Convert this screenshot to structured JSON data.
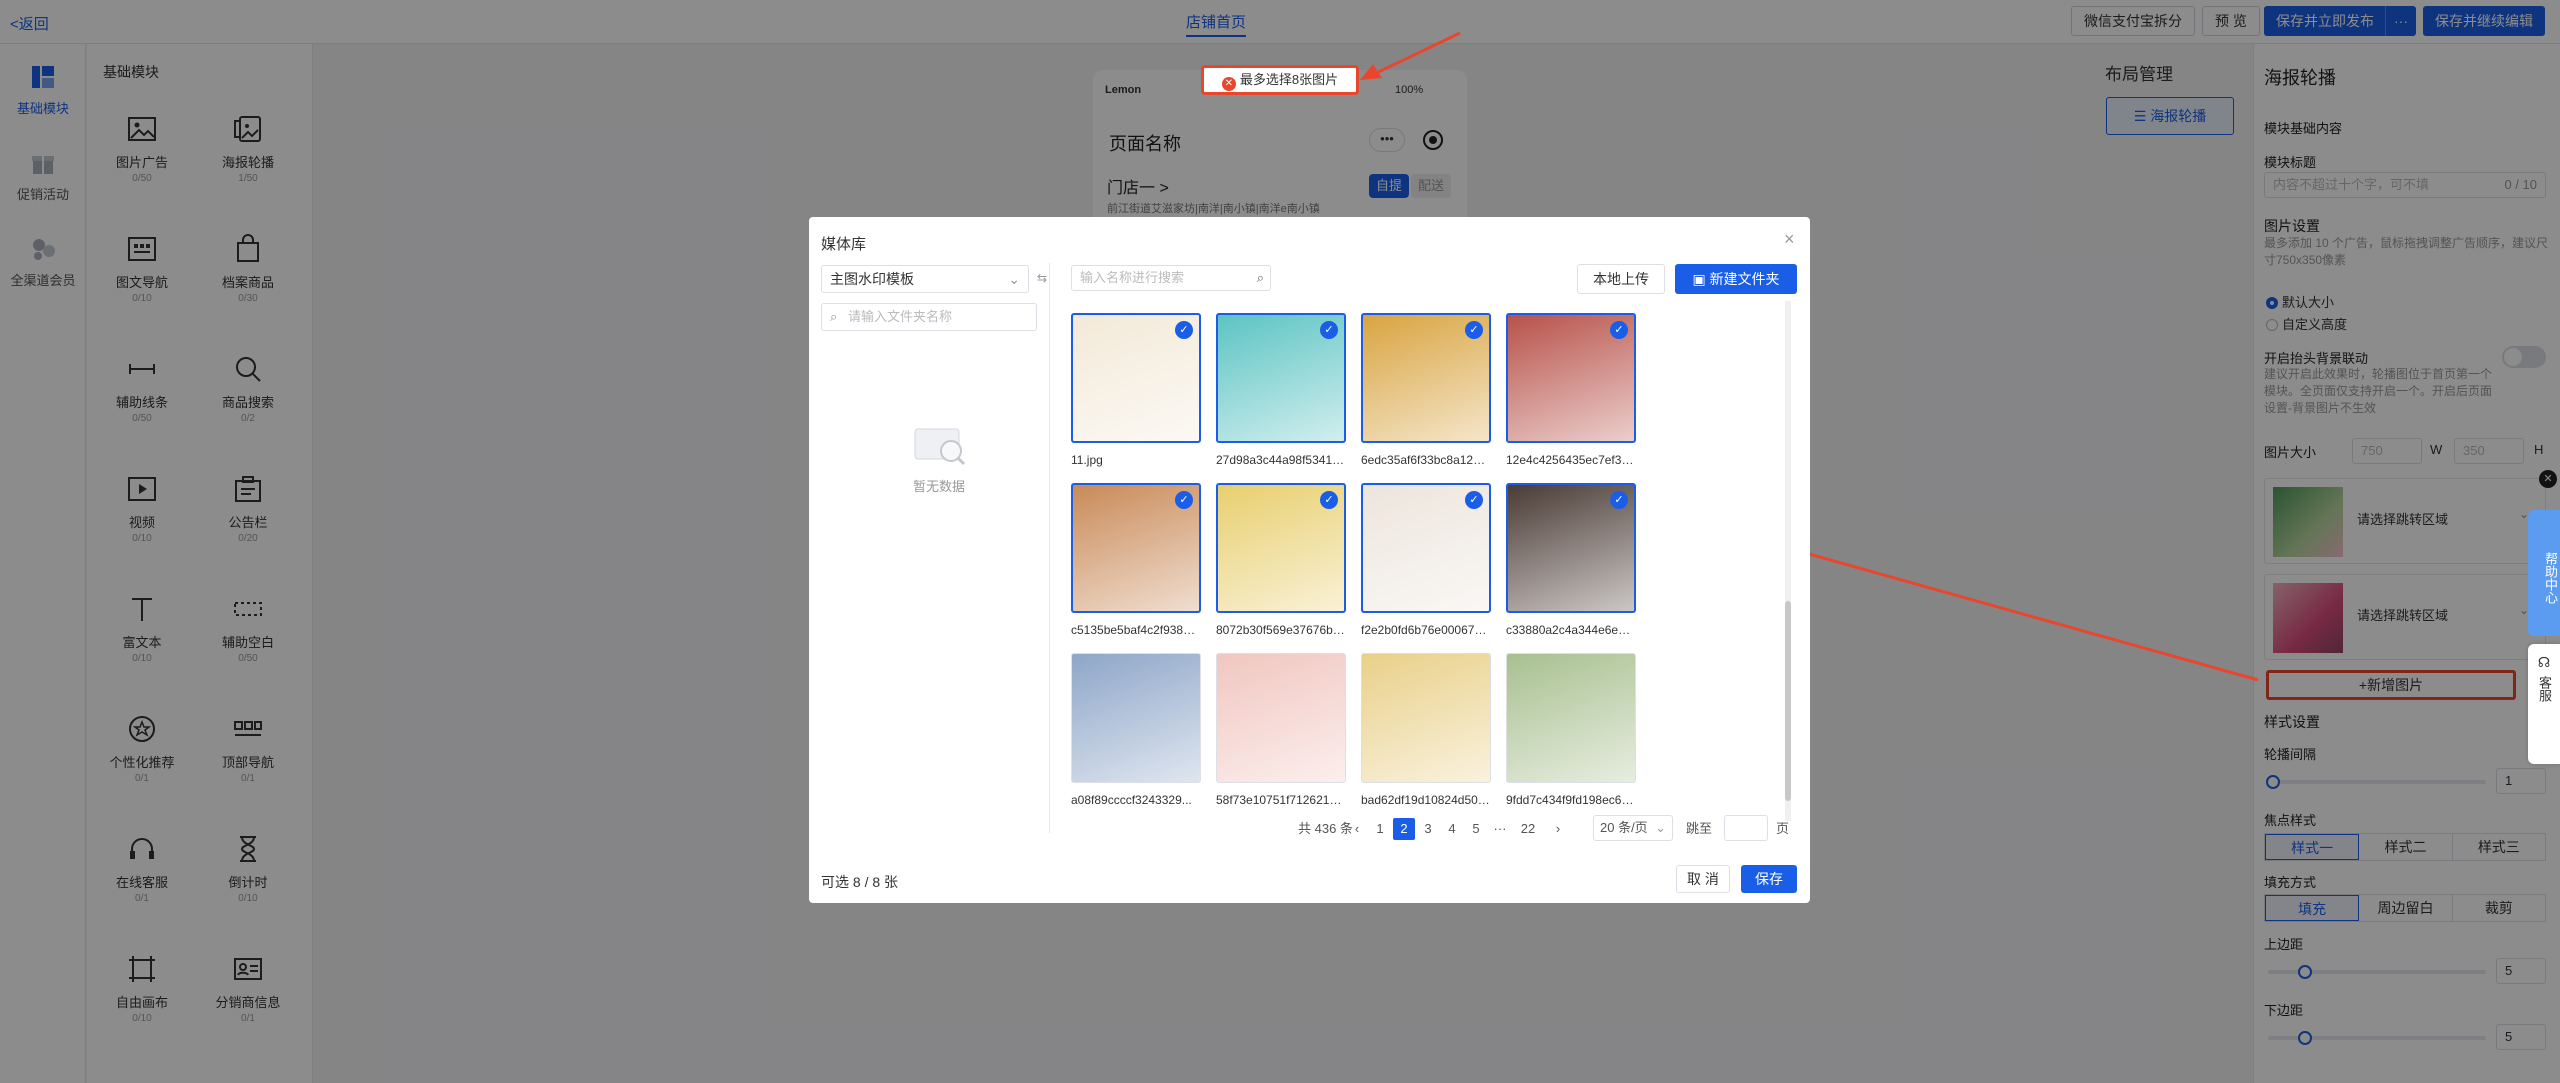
{
  "topbar": {
    "back": "<返回",
    "page_tab": "店铺首页",
    "btn_wechat_split": "微信支付宝拆分",
    "btn_preview": "预 览",
    "btn_save_publish": "保存并立即发布",
    "btn_more": "···",
    "btn_save_continue": "保存并继续编辑"
  },
  "rail": {
    "items": [
      {
        "label": "基础模块"
      },
      {
        "label": "促销活动"
      },
      {
        "label": "全渠道会员"
      }
    ]
  },
  "modules": {
    "header": "基础模块",
    "items": [
      {
        "name": "图片广告",
        "count": "0/50"
      },
      {
        "name": "海报轮播",
        "count": "1/50"
      },
      {
        "name": "图文导航",
        "count": "0/10"
      },
      {
        "name": "档案商品",
        "count": "0/30"
      },
      {
        "name": "辅助线条",
        "count": "0/50"
      },
      {
        "name": "商品搜索",
        "count": "0/2"
      },
      {
        "name": "视频",
        "count": "0/10"
      },
      {
        "name": "公告栏",
        "count": "0/20"
      },
      {
        "name": "富文本",
        "count": "0/10"
      },
      {
        "name": "辅助空白",
        "count": "0/50"
      },
      {
        "name": "个性化推荐",
        "count": "0/1"
      },
      {
        "name": "顶部导航",
        "count": "0/1"
      },
      {
        "name": "在线客服",
        "count": "0/1"
      },
      {
        "name": "倒计时",
        "count": "0/10"
      },
      {
        "name": "自由画布",
        "count": "0/10"
      },
      {
        "name": "分销商信息",
        "count": "0/1"
      }
    ]
  },
  "phone": {
    "carrier": "Lemon",
    "battery": "100%",
    "page_name": "页面名称",
    "store": "门店一 >",
    "address": "前江街道艾滋家坊|南洋|南小镇|南洋e南小镇",
    "tab_pickup": "自提",
    "tab_delivery": "配送"
  },
  "toast": {
    "text": "最多选择8张图片"
  },
  "layout": {
    "title": "布局管理",
    "button": "海报轮播"
  },
  "right_panel": {
    "title": "海报轮播",
    "basic_section": "模块基础内容",
    "module_title_label": "模块标题",
    "module_title_placeholder": "内容不超过十个字，可不填",
    "module_title_count": "0 / 10",
    "image_settings": "图片设置",
    "image_settings_hint": "最多添加 10 个广告，鼠标拖拽调整广告顺序，建议尺寸750x350像素",
    "radio_default": "默认大小",
    "radio_custom": "自定义高度",
    "bg_link_label": "开启抬头背景联动",
    "bg_link_hint": "建议开启此效果时，轮播图位于首页第一个模块。全页面仅支持开启一个。开启后页面设置-背景图片不生效",
    "img_size_label": "图片大小",
    "img_w_value": "750",
    "img_w_label": "W",
    "img_h_value": "350",
    "img_h_label": "H",
    "jump_placeholder_1": "请选择跳转区域",
    "jump_placeholder_2": "请选择跳转区域",
    "add_image": "+新增图片",
    "style_settings": "样式设置",
    "carousel_gap_label": "轮播间隔",
    "carousel_gap_value": "1",
    "focus_style_label": "焦点样式",
    "focus_styles": [
      "样式一",
      "样式二",
      "样式三"
    ],
    "fill_mode_label": "填充方式",
    "fill_modes": [
      "填充",
      "周边留白",
      "裁剪"
    ],
    "top_margin_label": "上边距",
    "top_margin_value": "5",
    "bottom_margin_label": "下边距",
    "bottom_margin_value": "5"
  },
  "side_widgets": {
    "help": "帮助中心",
    "service": "客服"
  },
  "modal": {
    "title": "媒体库",
    "close": "×",
    "folder_select": "主图水印模板",
    "folder_search_placeholder": "请输入文件夹名称",
    "empty_text": "暂无数据",
    "image_search_placeholder": "输入名称进行搜索",
    "upload_btn": "本地上传",
    "new_folder_btn": "新建文件夹",
    "images": [
      {
        "name": "11.jpg",
        "selected": true,
        "color": "#f3e9d8"
      },
      {
        "name": "27d98a3c44a98f5341c76...",
        "selected": true,
        "color": "#5cc4c3"
      },
      {
        "name": "6edc35af6f33bc8a12acc...",
        "selected": true,
        "color": "#d9a441"
      },
      {
        "name": "12e4c4256435ec7ef36f...",
        "selected": true,
        "color": "#b8524a"
      },
      {
        "name": "c5135be5baf4c2f9383e...",
        "selected": true,
        "color": "#c98a58"
      },
      {
        "name": "8072b30f569e37676b2...",
        "selected": true,
        "color": "#e8cf6f"
      },
      {
        "name": "f2e2b0fd6b76e0006788d...",
        "selected": true,
        "color": "#ece5dc"
      },
      {
        "name": "c33880a2c4a344e6e343...",
        "selected": true,
        "color": "#4a3b35"
      },
      {
        "name": "a08f89ccccf3243329...",
        "selected": false,
        "color": "#8ea6c8"
      },
      {
        "name": "58f73e10751f71262157...",
        "selected": false,
        "color": "#f1c6c0"
      },
      {
        "name": "bad62df19d10824d50c8...",
        "selected": false,
        "color": "#e9d089"
      },
      {
        "name": "9fdd7c434f9fd198ec64...",
        "selected": false,
        "color": "#a8c090"
      }
    ],
    "pagination": {
      "total": "共 436 条",
      "pages": [
        "1",
        "2",
        "3",
        "4",
        "5",
        "···",
        "22"
      ],
      "current": "2",
      "page_size": "20 条/页",
      "jump_label": "跳至",
      "page_unit": "页"
    },
    "available": "可选 8 / 8 张",
    "cancel": "取 消",
    "save": "保存"
  },
  "colors": {
    "primary": "#1a5ee8",
    "annotation": "#e8462d"
  }
}
